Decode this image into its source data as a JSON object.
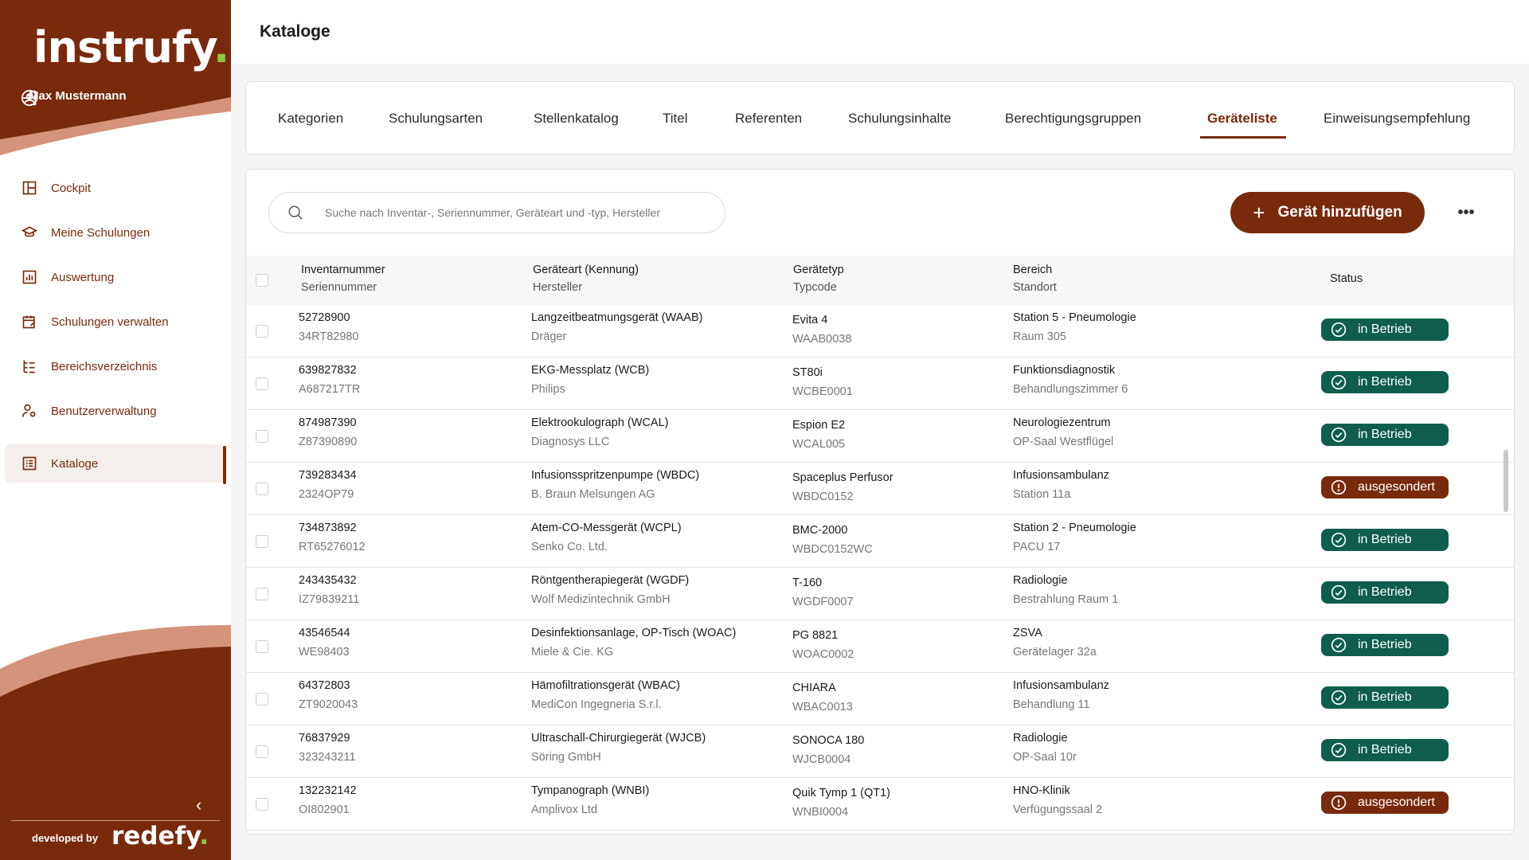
{
  "brand": {
    "logo_text": "instrufy",
    "logo_dot": ".",
    "footer_prefix": "developed by",
    "footer_brand": "redefy",
    "footer_dot": "."
  },
  "user": {
    "name": "Max Mustermann"
  },
  "nav": [
    {
      "label": "Cockpit",
      "icon": "dashboard-icon"
    },
    {
      "label": "Meine Schulungen",
      "icon": "graduation-cap-icon"
    },
    {
      "label": "Auswertung",
      "icon": "chart-icon"
    },
    {
      "label": "Schulungen verwalten",
      "icon": "calendar-edit-icon"
    },
    {
      "label": "Bereichsverzeichnis",
      "icon": "tree-icon"
    },
    {
      "label": "Benutzerverwaltung",
      "icon": "user-settings-icon"
    },
    {
      "label": "Kataloge",
      "icon": "catalog-icon",
      "active": true
    }
  ],
  "page": {
    "title": "Kataloge"
  },
  "tabs": [
    "Kategorien",
    "Schulungsarten",
    "Stellenkatalog",
    "Titel",
    "Referenten",
    "Schulungsinhalte",
    "Berechtigungsgruppen",
    "Geräteliste",
    "Einweisungsempfehlung"
  ],
  "active_tab": "Geräteliste",
  "search": {
    "placeholder": "Suche nach Inventar-, Seriennummer, Geräteart und -typ, Hersteller"
  },
  "actions": {
    "add_label": "Gerät hinzufügen",
    "more_label": "•••"
  },
  "table": {
    "headers": {
      "inv": "Inventarnummer",
      "serial": "Seriennummer",
      "type": "Geräteart (Kennung)",
      "maker": "Hersteller",
      "model": "Gerätetyp",
      "typecode": "Typcode",
      "area": "Bereich",
      "location": "Standort",
      "status": "Status"
    },
    "rows": [
      {
        "inv": "52728900",
        "serial": "34RT82980",
        "type": "Langzeitbeatmungsgerät (WAAB)",
        "maker": "Dräger",
        "model": "Evita 4",
        "typecode": "WAAB0038",
        "area": "Station 5 - Pneumologie",
        "location": "Raum 305",
        "status": "in Betrieb",
        "status_kind": "ok"
      },
      {
        "inv": "639827832",
        "serial": "A687217TR",
        "type": "EKG-Messplatz (WCB)",
        "maker": "Philips",
        "model": "ST80i",
        "typecode": "WCBE0001",
        "area": "Funktionsdiagnostik",
        "location": "Behandlungszimmer 6",
        "status": "in Betrieb",
        "status_kind": "ok"
      },
      {
        "inv": "874987390",
        "serial": "Z87390890",
        "type": "Elektrookulograph (WCAL)",
        "maker": "Diagnosys LLC",
        "model": "Espion E2",
        "typecode": "WCAL005",
        "area": "Neurologiezentrum",
        "location": "OP-Saal Westflügel",
        "status": "in Betrieb",
        "status_kind": "ok"
      },
      {
        "inv": "739283434",
        "serial": "2324OP79",
        "type": "Infusionsspritzenpumpe (WBDC)",
        "maker": "B. Braun Melsungen AG",
        "model": "Spaceplus Perfusor",
        "typecode": "WBDC0152",
        "area": "Infusionsambulanz",
        "location": "Station 11a",
        "status": "ausgesondert",
        "status_kind": "off"
      },
      {
        "inv": "734873892",
        "serial": "RT65276012",
        "type": "Atem-CO-Messgerät (WCPL)",
        "maker": "Senko Co. Ltd.",
        "model": "BMC-2000",
        "typecode": "WBDC0152WC",
        "area": "Station 2 - Pneumologie",
        "location": "PACU 17",
        "status": "in Betrieb",
        "status_kind": "ok"
      },
      {
        "inv": "243435432",
        "serial": "IZ79839211",
        "type": "Röntgentherapiegerät (WGDF)",
        "maker": "Wolf Medizintechnik GmbH",
        "model": "T-160",
        "typecode": "WGDF0007",
        "area": "Radiologie",
        "location": "Bestrahlung Raum 1",
        "status": "in Betrieb",
        "status_kind": "ok"
      },
      {
        "inv": "43546544",
        "serial": "WE98403",
        "type": "Desinfektionsanlage, OP-Tisch (WOAC)",
        "maker": "Miele & Cie. KG",
        "model": "PG 8821",
        "typecode": "WOAC0002",
        "area": "ZSVA",
        "location": "Gerätelager 32a",
        "status": "in Betrieb",
        "status_kind": "ok"
      },
      {
        "inv": "64372803",
        "serial": "ZT9020043",
        "type": "Hämofiltrationsgerät (WBAC)",
        "maker": "MediCon Ingegneria S.r.l.",
        "model": "CHIARA",
        "typecode": "WBAC0013",
        "area": "Infusionsambulanz",
        "location": "Behandlung 11",
        "status": "in Betrieb",
        "status_kind": "ok"
      },
      {
        "inv": "76837929",
        "serial": "323243211",
        "type": "Ultraschall-Chirurgiegerät (WJCB)",
        "maker": "Söring GmbH",
        "model": "SONOCA 180",
        "typecode": "WJCB0004",
        "area": "Radiologie",
        "location": "OP-Saal 10r",
        "status": "in Betrieb",
        "status_kind": "ok"
      },
      {
        "inv": "132232142",
        "serial": "OI802901",
        "type": "Tympanograph (WNBI)",
        "maker": "Amplivox Ltd",
        "model": "Quik Tymp 1 (QT1)",
        "typecode": "WNBI0004",
        "area": "HNO-Klinik",
        "location": "Verfügungssaal 2",
        "status": "ausgesondert",
        "status_kind": "off"
      }
    ]
  },
  "colors": {
    "brand": "#7a2a0c",
    "accent_light": "#d4937a",
    "ok": "#0f5e4d",
    "logo_dot": "#8cc63f"
  }
}
